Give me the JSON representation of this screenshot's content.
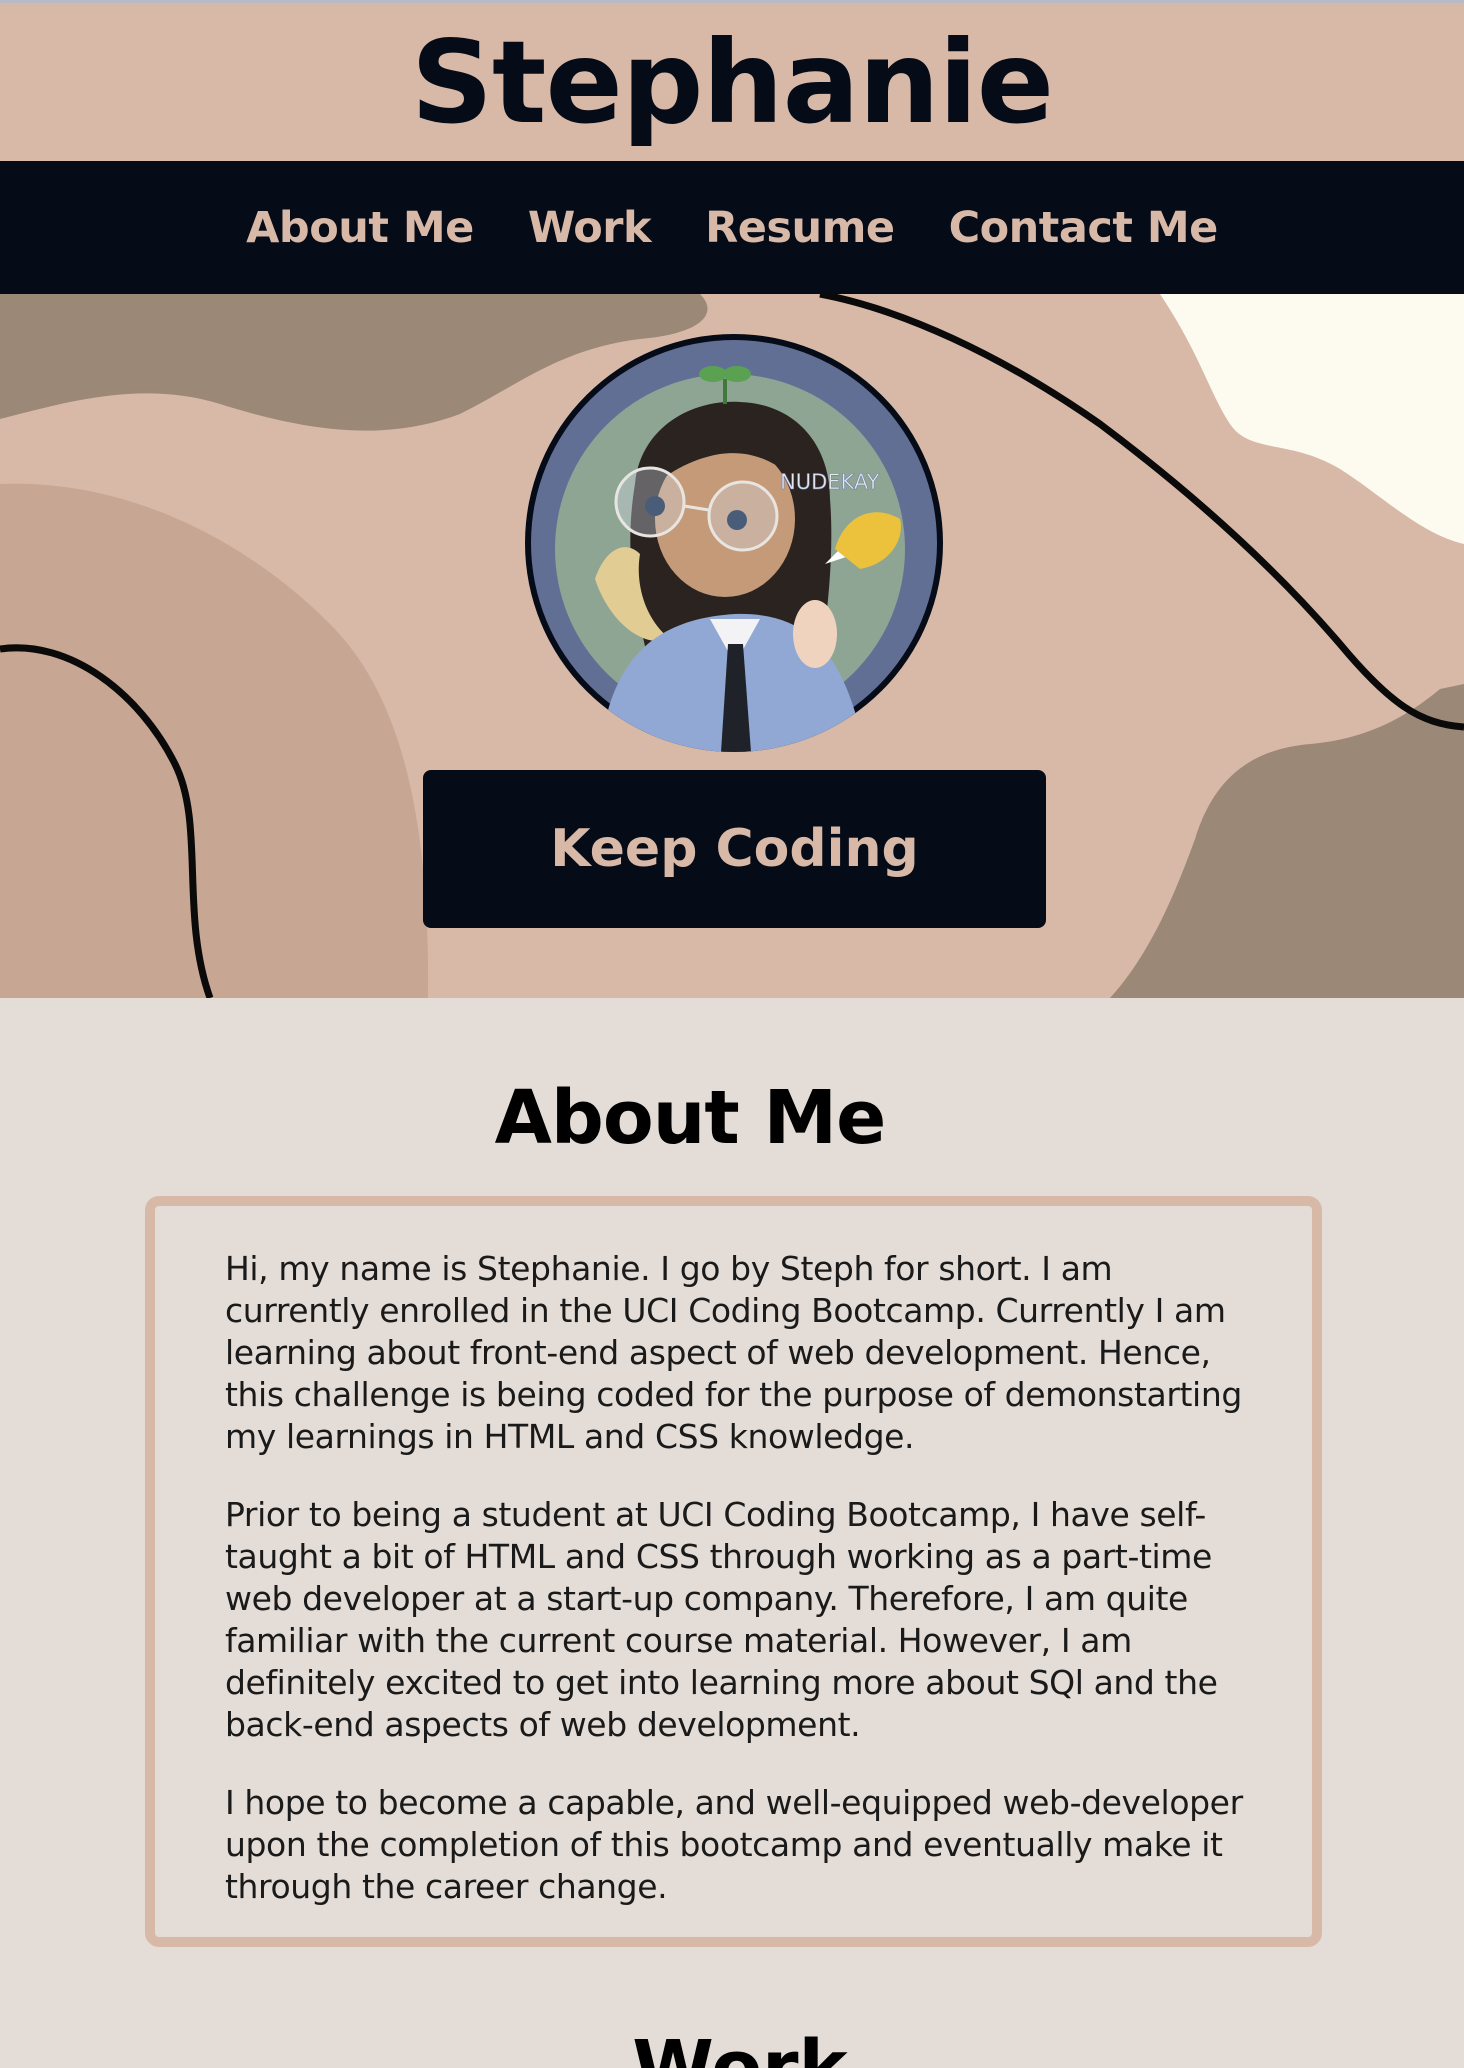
{
  "header": {
    "title": "Stephanie"
  },
  "nav": {
    "items": [
      {
        "label": "About Me"
      },
      {
        "label": "Work"
      },
      {
        "label": "Resume"
      },
      {
        "label": "Contact Me"
      }
    ]
  },
  "hero": {
    "avatar_watermark": "NUDEKAY",
    "button_label": "Keep Coding"
  },
  "about": {
    "heading": "About Me",
    "paragraphs": [
      "Hi, my name is Stephanie. I go by Steph for short. I am currently enrolled in the UCI Coding Bootcamp. Currently I am learning about front-end aspect of web development. Hence, this challenge is being coded for the purpose of demonstarting my learnings in HTML and CSS knowledge.",
      "Prior to being a student at UCI Coding Bootcamp, I have self-taught a bit of HTML and CSS through working as a part-time web developer at a start-up company. Therefore, I am quite familiar with the current course material. However, I am definitely excited to get into learning more about SQl and the back-end aspects of web development.",
      "I hope to become a capable, and well-equipped web-developer upon the completion of this bootcamp and eventually make it through the career change."
    ]
  },
  "work": {
    "heading": "Work"
  },
  "colors": {
    "accent": "#d8b9a8",
    "dark": "#060b18",
    "page_background": "#e4ddd7"
  }
}
